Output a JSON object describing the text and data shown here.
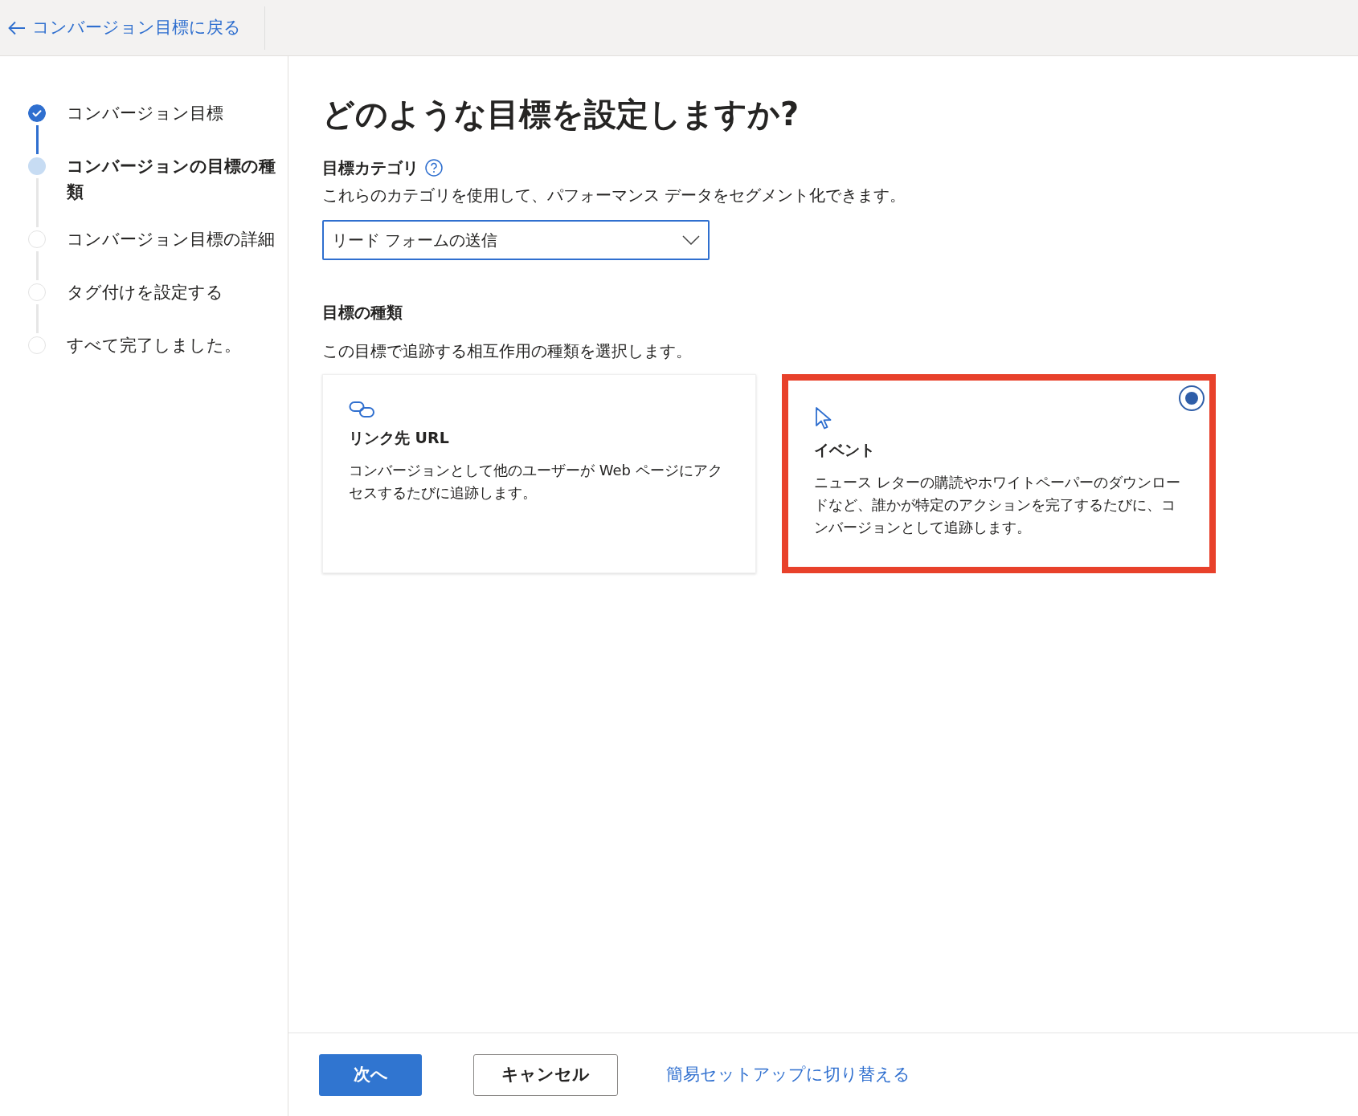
{
  "header": {
    "back_link": "コンバージョン目標に戻る"
  },
  "steps": [
    {
      "label": "コンバージョン目標",
      "completed": true,
      "selected": false
    },
    {
      "label": "コンバージョンの目標の種類",
      "completed": false,
      "selected": true
    },
    {
      "label": "コンバージョン目標の詳細",
      "completed": false,
      "selected": false
    },
    {
      "label": "タグ付けを設定する",
      "completed": false,
      "selected": false
    },
    {
      "label": "すべて完了しました。",
      "completed": false,
      "selected": false
    }
  ],
  "title": "どのような目標を設定しますか?",
  "category": {
    "label": "目標カテゴリ",
    "description": "これらのカテゴリを使用して、パフォーマンス データをセグメント化できます。",
    "value": "リード フォームの送信"
  },
  "goal_type": {
    "label": "目標の種類",
    "description": "この目標で追跡する相互作用の種類を選択します。",
    "cards": [
      {
        "kind": "link",
        "title": "リンク先 URL",
        "description": "コンバージョンとして他のユーザーが Web ページにアクセスするたびに追跡します。",
        "selected": false,
        "highlighted": false
      },
      {
        "kind": "event",
        "title": "イベント",
        "description": "ニュース レターの購読やホワイトペーパーのダウンロードなど、誰かが特定のアクションを完了するたびに、コンバージョンとして追跡します。",
        "selected": true,
        "highlighted": true
      }
    ]
  },
  "footer": {
    "next_button": "次へ",
    "cancel_button": "キャンセル",
    "switch_link": "簡易セットアップに切り替える"
  }
}
